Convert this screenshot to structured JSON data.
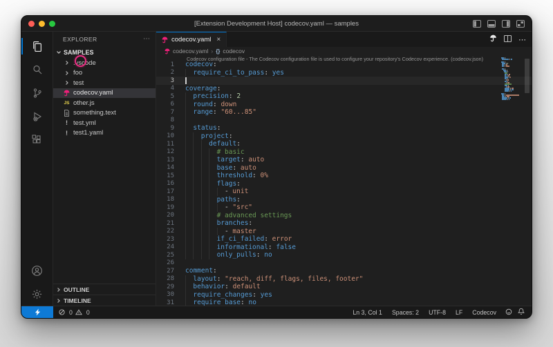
{
  "window": {
    "title": "[Extension Development Host] codecov.yaml — samples"
  },
  "colors": {
    "accent": "#0078d4",
    "codecov_pink": "#f01f7a",
    "remote_bg": "#0e7ad6",
    "key": "#569cd6",
    "string": "#ce9178",
    "number": "#b5cea8",
    "comment": "#6a9955"
  },
  "sidebar": {
    "title": "EXPLORER",
    "more": "⋯",
    "section": "SAMPLES",
    "files": [
      {
        "label": ".vscode",
        "icon": "chevron"
      },
      {
        "label": "foo",
        "icon": "chevron"
      },
      {
        "label": "test",
        "icon": "chevron"
      },
      {
        "label": "codecov.yaml",
        "icon": "codecov",
        "selected": true
      },
      {
        "label": "other.js",
        "icon": "js"
      },
      {
        "label": "something.text",
        "icon": "file"
      },
      {
        "label": "test.yml",
        "icon": "yaml"
      },
      {
        "label": "test1.yaml",
        "icon": "yaml"
      }
    ],
    "bottom_sections": [
      "OUTLINE",
      "TIMELINE"
    ]
  },
  "editor": {
    "tab": {
      "label": "codecov.yaml",
      "close": "×",
      "more": "⋯"
    },
    "breadcrumb": {
      "file": "codecov.yaml",
      "separator": "›",
      "symbol_braces": "{}",
      "symbol": "codecov"
    },
    "hover_description": "Codecov configuration file - The Codecov configuration file is used to configure your repository's Codecov experience. (codecov.json)",
    "cursor": {
      "line": 3,
      "col": 1
    },
    "code": [
      {
        "n": 1,
        "ind": 0,
        "toks": [
          [
            "codecov",
            "key"
          ],
          [
            ":",
            "pun"
          ]
        ]
      },
      {
        "n": 2,
        "ind": 1,
        "toks": [
          [
            "require_ci_to_pass",
            "key"
          ],
          [
            ": ",
            "pun"
          ],
          [
            "yes",
            "bool"
          ]
        ]
      },
      {
        "n": 3,
        "ind": 0,
        "toks": []
      },
      {
        "n": 4,
        "ind": 0,
        "toks": [
          [
            "coverage",
            "key"
          ],
          [
            ":",
            "pun"
          ]
        ]
      },
      {
        "n": 5,
        "ind": 1,
        "toks": [
          [
            "precision",
            "key"
          ],
          [
            ": ",
            "pun"
          ],
          [
            "2",
            "num"
          ]
        ]
      },
      {
        "n": 6,
        "ind": 1,
        "toks": [
          [
            "round",
            "key"
          ],
          [
            ": ",
            "pun"
          ],
          [
            "down",
            "str"
          ]
        ]
      },
      {
        "n": 7,
        "ind": 1,
        "toks": [
          [
            "range",
            "key"
          ],
          [
            ": ",
            "pun"
          ],
          [
            "\"60...85\"",
            "str"
          ]
        ]
      },
      {
        "n": 8,
        "ind": 1,
        "toks": []
      },
      {
        "n": 9,
        "ind": 1,
        "toks": [
          [
            "status",
            "key"
          ],
          [
            ":",
            "pun"
          ]
        ]
      },
      {
        "n": 10,
        "ind": 2,
        "toks": [
          [
            "project",
            "key"
          ],
          [
            ":",
            "pun"
          ]
        ]
      },
      {
        "n": 11,
        "ind": 3,
        "toks": [
          [
            "default",
            "key"
          ],
          [
            ":",
            "pun"
          ]
        ]
      },
      {
        "n": 12,
        "ind": 4,
        "toks": [
          [
            "# basic",
            "cmt"
          ]
        ]
      },
      {
        "n": 13,
        "ind": 4,
        "toks": [
          [
            "target",
            "key"
          ],
          [
            ": ",
            "pun"
          ],
          [
            "auto",
            "str"
          ]
        ]
      },
      {
        "n": 14,
        "ind": 4,
        "toks": [
          [
            "base",
            "key"
          ],
          [
            ": ",
            "pun"
          ],
          [
            "auto",
            "str"
          ]
        ]
      },
      {
        "n": 15,
        "ind": 4,
        "toks": [
          [
            "threshold",
            "key"
          ],
          [
            ": ",
            "pun"
          ],
          [
            "0%",
            "str"
          ]
        ]
      },
      {
        "n": 16,
        "ind": 4,
        "toks": [
          [
            "flags",
            "key"
          ],
          [
            ":",
            "pun"
          ]
        ]
      },
      {
        "n": 17,
        "ind": 5,
        "toks": [
          [
            "- ",
            "pun"
          ],
          [
            "unit",
            "str"
          ]
        ]
      },
      {
        "n": 18,
        "ind": 4,
        "toks": [
          [
            "paths",
            "key"
          ],
          [
            ":",
            "pun"
          ]
        ]
      },
      {
        "n": 19,
        "ind": 5,
        "toks": [
          [
            "- ",
            "pun"
          ],
          [
            "\"src\"",
            "str"
          ]
        ]
      },
      {
        "n": 20,
        "ind": 4,
        "toks": [
          [
            "# advanced settings",
            "cmt"
          ]
        ]
      },
      {
        "n": 21,
        "ind": 4,
        "toks": [
          [
            "branches",
            "key"
          ],
          [
            ":",
            "pun"
          ]
        ]
      },
      {
        "n": 22,
        "ind": 5,
        "toks": [
          [
            "- ",
            "pun"
          ],
          [
            "master",
            "str"
          ]
        ]
      },
      {
        "n": 23,
        "ind": 4,
        "toks": [
          [
            "if_ci_failed",
            "key"
          ],
          [
            ": ",
            "pun"
          ],
          [
            "error",
            "str"
          ]
        ]
      },
      {
        "n": 24,
        "ind": 4,
        "toks": [
          [
            "informational",
            "key"
          ],
          [
            ": ",
            "pun"
          ],
          [
            "false",
            "bool"
          ]
        ]
      },
      {
        "n": 25,
        "ind": 4,
        "toks": [
          [
            "only_pulls",
            "key"
          ],
          [
            ": ",
            "pun"
          ],
          [
            "no",
            "bool"
          ]
        ]
      },
      {
        "n": 26,
        "ind": 0,
        "toks": []
      },
      {
        "n": 27,
        "ind": 0,
        "toks": [
          [
            "comment",
            "key"
          ],
          [
            ":",
            "pun"
          ]
        ]
      },
      {
        "n": 28,
        "ind": 1,
        "toks": [
          [
            "layout",
            "key"
          ],
          [
            ": ",
            "pun"
          ],
          [
            "\"reach, diff, flags, files, footer\"",
            "str"
          ]
        ]
      },
      {
        "n": 29,
        "ind": 1,
        "toks": [
          [
            "behavior",
            "key"
          ],
          [
            ": ",
            "pun"
          ],
          [
            "default",
            "str"
          ]
        ]
      },
      {
        "n": 30,
        "ind": 1,
        "toks": [
          [
            "require_changes",
            "key"
          ],
          [
            ": ",
            "pun"
          ],
          [
            "yes",
            "bool"
          ]
        ]
      },
      {
        "n": 31,
        "ind": 1,
        "toks": [
          [
            "require_base",
            "key"
          ],
          [
            ": ",
            "pun"
          ],
          [
            "no",
            "bool"
          ]
        ]
      }
    ]
  },
  "status_bar": {
    "errors": "0",
    "warnings": "0",
    "right": [
      "Ln 3, Col 1",
      "Spaces: 2",
      "UTF-8",
      "LF",
      "Codecov"
    ]
  }
}
